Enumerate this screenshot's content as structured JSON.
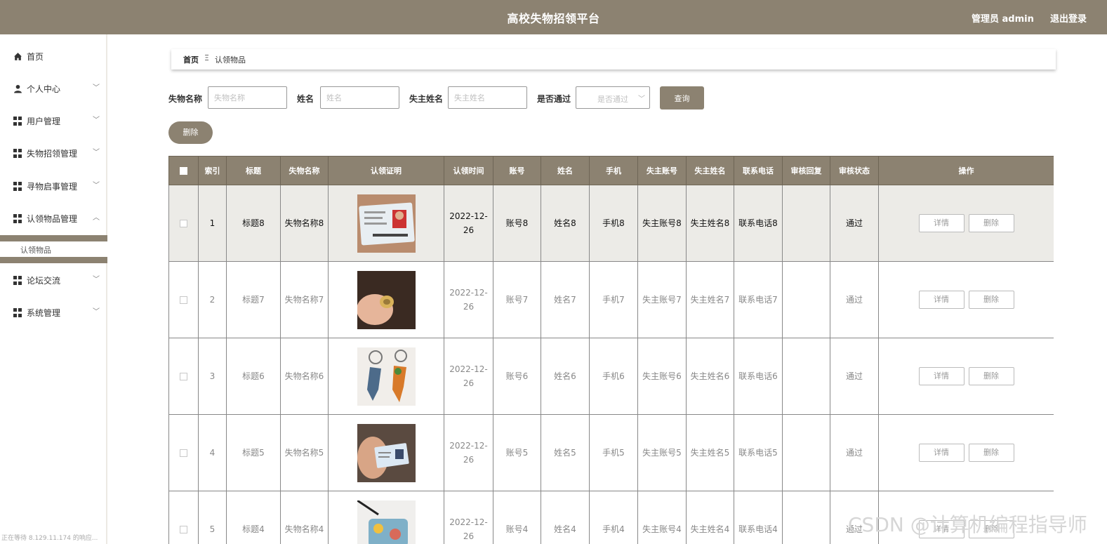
{
  "header": {
    "title": "高校失物招领平台",
    "admin_label": "管理员 admin",
    "logout_label": "退出登录"
  },
  "sidebar": {
    "items": [
      {
        "label": "首页",
        "icon": "home-icon"
      },
      {
        "label": "个人中心",
        "icon": "user-icon"
      },
      {
        "label": "用户管理",
        "icon": "grid-icon"
      },
      {
        "label": "失物招领管理",
        "icon": "grid-icon"
      },
      {
        "label": "寻物启事管理",
        "icon": "grid-icon"
      },
      {
        "label": "认领物品管理",
        "icon": "grid-icon"
      },
      {
        "label": "论坛交流",
        "icon": "grid-icon"
      },
      {
        "label": "系统管理",
        "icon": "grid-icon"
      }
    ],
    "sub_item": "认领物品",
    "status_text": "正在等待 8.129.11.174 的响应..."
  },
  "breadcrumb": {
    "home": "首页",
    "separator": "Ξ",
    "current": "认领物品"
  },
  "search": {
    "lost_name_label": "失物名称",
    "lost_name_placeholder": "失物名称",
    "name_label": "姓名",
    "name_placeholder": "姓名",
    "owner_name_label": "失主姓名",
    "owner_name_placeholder": "失主姓名",
    "approved_label": "是否通过",
    "approved_placeholder": "是否通过",
    "query_button": "查询",
    "delete_button": "删除"
  },
  "table": {
    "headers": [
      "索引",
      "标题",
      "失物名称",
      "认领证明",
      "认领时间",
      "账号",
      "姓名",
      "手机",
      "失主账号",
      "失主姓名",
      "联系电话",
      "审核回复",
      "审核状态",
      "操作"
    ],
    "detail_label": "详情",
    "delete_label": "删除",
    "rows": [
      {
        "index": "1",
        "title": "标题8",
        "lost_name": "失物名称8",
        "time": "2022-12-26",
        "account": "账号8",
        "name": "姓名8",
        "phone": "手机8",
        "owner_account": "失主账号8",
        "owner_name": "失主姓名8",
        "contact": "联系电话8",
        "reply": "",
        "status": "通过",
        "image": "id-card-photo"
      },
      {
        "index": "2",
        "title": "标题7",
        "lost_name": "失物名称7",
        "time": "2022-12-26",
        "account": "账号7",
        "name": "姓名7",
        "phone": "手机7",
        "owner_account": "失主账号7",
        "owner_name": "失主姓名7",
        "contact": "联系电话7",
        "reply": "",
        "status": "通过",
        "image": "ring-photo"
      },
      {
        "index": "3",
        "title": "标题6",
        "lost_name": "失物名称6",
        "time": "2022-12-26",
        "account": "账号6",
        "name": "姓名6",
        "phone": "手机6",
        "owner_account": "失主账号6",
        "owner_name": "失主姓名6",
        "contact": "联系电话6",
        "reply": "",
        "status": "通过",
        "image": "keychain-photo"
      },
      {
        "index": "4",
        "title": "标题5",
        "lost_name": "失物名称5",
        "time": "2022-12-26",
        "account": "账号5",
        "name": "姓名5",
        "phone": "手机5",
        "owner_account": "失主账号5",
        "owner_name": "失主姓名5",
        "contact": "联系电话5",
        "reply": "",
        "status": "通过",
        "image": "card-in-hand-photo"
      },
      {
        "index": "5",
        "title": "标题4",
        "lost_name": "失物名称4",
        "time": "2022-12-26",
        "account": "账号4",
        "name": "姓名4",
        "phone": "手机4",
        "owner_account": "失主账号4",
        "owner_name": "失主姓名4",
        "contact": "联系电话4",
        "reply": "",
        "status": "通过",
        "image": "tag-photo"
      }
    ]
  },
  "watermark": "CSDN @计算机编程指导师",
  "colors": {
    "brand": "#8c8271",
    "selected_row": "#ecebe7"
  }
}
